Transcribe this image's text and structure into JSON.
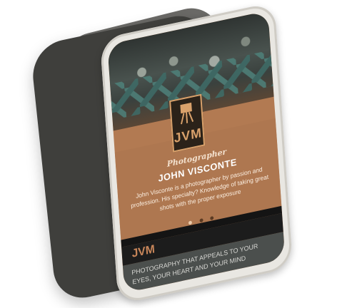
{
  "app": {
    "role": "Photographer",
    "name": "JOHN VISCONTE",
    "bio": "John Visconte is a photographer by passion and profession. His specialty? Knowledge of taking great shots with the proper exposure",
    "logo_text": "JVM",
    "brand": "JVM",
    "tagline": "PHOTOGRAPHY THAT APPEALS TO YOUR EYES, YOUR HEART AND YOUR MIND"
  },
  "carousel": {
    "dots": 3,
    "active_index": 0
  },
  "colors": {
    "accent": "#ae7750",
    "logo": "#d9a16b",
    "dark": "#1c1c1c",
    "tagline_bg": "#4b4f4d"
  },
  "icons": [
    "camera-tripod-icon"
  ]
}
